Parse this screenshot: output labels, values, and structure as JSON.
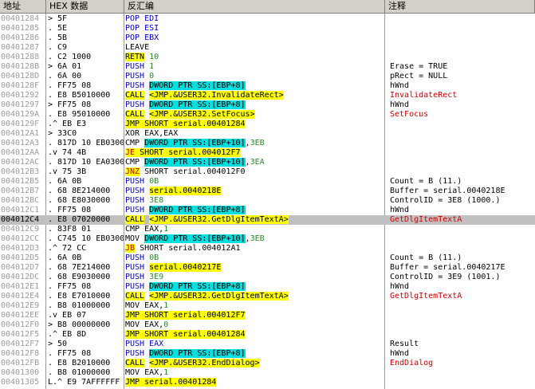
{
  "headers": {
    "address": "地址",
    "hex": "HEX 数据",
    "disasm": "反汇编",
    "comment": "注释"
  },
  "rows": [
    {
      "addr": "00401284",
      "hex": "> 5F",
      "dis": [
        [
          "POP EDI",
          "b"
        ]
      ],
      "com": ""
    },
    {
      "addr": "00401285",
      "hex": ". 5E",
      "dis": [
        [
          "POP ESI",
          "b"
        ]
      ],
      "com": ""
    },
    {
      "addr": "00401286",
      "hex": ". 5B",
      "dis": [
        [
          "POP EBX",
          "b"
        ]
      ],
      "com": ""
    },
    {
      "addr": "00401287",
      "hex": ". C9",
      "dis": [
        [
          "LEAVE",
          ""
        ]
      ],
      "com": ""
    },
    {
      "addr": "00401288",
      "hex": ". C2 1000",
      "dis": [
        [
          "RETN",
          "ky"
        ],
        [
          " 10",
          "g"
        ]
      ],
      "com": ""
    },
    {
      "addr": "0040128B",
      "hex": "> 6A 01",
      "dis": [
        [
          "PUSH ",
          "b"
        ],
        [
          "1",
          "g"
        ]
      ],
      "com": "Erase = TRUE"
    },
    {
      "addr": "0040128D",
      "hex": ". 6A 00",
      "dis": [
        [
          "PUSH ",
          "b"
        ],
        [
          "0",
          "g"
        ]
      ],
      "com": "pRect = NULL"
    },
    {
      "addr": "0040128F",
      "hex": ". FF75 08",
      "dis": [
        [
          "PUSH ",
          "b"
        ],
        [
          "DWORD PTR SS:[EBP+8]",
          "c"
        ]
      ],
      "com": "hWnd"
    },
    {
      "addr": "00401292",
      "hex": ". E8 B5010000",
      "dis": [
        [
          "CALL",
          "y"
        ],
        [
          " ",
          ""
        ],
        [
          "<JMP.&USER32.InvalidateRect>",
          "y"
        ]
      ],
      "com": "InvalidateRect",
      "comRed": true
    },
    {
      "addr": "00401297",
      "hex": "> FF75 08",
      "dis": [
        [
          "PUSH ",
          "b"
        ],
        [
          "DWORD PTR SS:[EBP+8]",
          "c"
        ]
      ],
      "com": "hWnd"
    },
    {
      "addr": "0040129A",
      "hex": ". E8 95010000",
      "dis": [
        [
          "CALL",
          "y"
        ],
        [
          " ",
          ""
        ],
        [
          "<JMP.&USER32.SetFocus>",
          "y"
        ]
      ],
      "com": "SetFocus",
      "comRed": true
    },
    {
      "addr": "0040129F",
      "hex": ".^ EB E3",
      "dis": [
        [
          "JMP SHORT serial.00401284",
          "y"
        ]
      ],
      "com": ""
    },
    {
      "addr": "004012A1",
      "hex": "> 33C0",
      "dis": [
        [
          "XOR EAX,EAX",
          ""
        ]
      ],
      "com": ""
    },
    {
      "addr": "004012A3",
      "hex": ". 817D 10 EB03000",
      "dis": [
        [
          "CMP ",
          ""
        ],
        [
          "DWORD PTR SS:[EBP+10]",
          "c"
        ],
        [
          ",",
          ""
        ],
        [
          "3EB",
          "g"
        ]
      ],
      "com": ""
    },
    {
      "addr": "004012AA",
      "hex": ".v 74 4B",
      "dis": [
        [
          "JE",
          "yr"
        ],
        [
          " SHORT serial.004012F7",
          "y"
        ]
      ],
      "com": ""
    },
    {
      "addr": "004012AC",
      "hex": ". 817D 10 EA03000",
      "dis": [
        [
          "CMP ",
          ""
        ],
        [
          "DWORD PTR SS:[EBP+10]",
          "c"
        ],
        [
          ",",
          ""
        ],
        [
          "3EA",
          "g"
        ]
      ],
      "com": ""
    },
    {
      "addr": "004012B3",
      "hex": ".v 75 3B",
      "dis": [
        [
          "JNZ",
          "yr"
        ],
        [
          " SHORT serial.004012F0",
          ""
        ]
      ],
      "com": ""
    },
    {
      "addr": "004012B5",
      "hex": ". 6A 0B",
      "dis": [
        [
          "PUSH ",
          "b"
        ],
        [
          "0B",
          "g"
        ]
      ],
      "com": "Count = B (11.)"
    },
    {
      "addr": "004012B7",
      "hex": ". 68 8E214000",
      "dis": [
        [
          "PUSH ",
          "b"
        ],
        [
          "serial.0040218E",
          "y"
        ]
      ],
      "com": "Buffer = serial.0040218E"
    },
    {
      "addr": "004012BC",
      "hex": ". 68 E8030000",
      "dis": [
        [
          "PUSH ",
          "b"
        ],
        [
          "3E8",
          "g"
        ]
      ],
      "com": "ControlID = 3E8 (1000.)"
    },
    {
      "addr": "004012C1",
      "hex": ". FF75 08",
      "dis": [
        [
          "PUSH ",
          "b"
        ],
        [
          "DWORD PTR SS:[EBP+8]",
          "c"
        ]
      ],
      "com": "hWnd"
    },
    {
      "addr": "004012C4",
      "hex": ". E8 07020000",
      "dis": [
        [
          "CALL",
          "y"
        ],
        [
          " ",
          ""
        ],
        [
          "<JMP.&USER32.GetDlgItemTextA>",
          "y"
        ]
      ],
      "com": "GetDlgItemTextA",
      "comRed": true,
      "sel": true
    },
    {
      "addr": "004012C9",
      "hex": ". 83F8 01",
      "dis": [
        [
          "CMP EAX,",
          ""
        ],
        [
          "1",
          "g"
        ]
      ],
      "com": ""
    },
    {
      "addr": "004012CC",
      "hex": ". C745 10 EB03000",
      "dis": [
        [
          "MOV ",
          ""
        ],
        [
          "DWORD PTR SS:[EBP+10]",
          "c"
        ],
        [
          ",",
          ""
        ],
        [
          "3EB",
          "g"
        ]
      ],
      "com": ""
    },
    {
      "addr": "004012D3",
      "hex": ".^ 72 CC",
      "dis": [
        [
          "JB",
          "yr"
        ],
        [
          " SHORT serial.004012A1",
          ""
        ]
      ],
      "com": ""
    },
    {
      "addr": "004012D5",
      "hex": ". 6A 0B",
      "dis": [
        [
          "PUSH ",
          "b"
        ],
        [
          "0B",
          "g"
        ]
      ],
      "com": "Count = B (11.)"
    },
    {
      "addr": "004012D7",
      "hex": ". 68 7E214000",
      "dis": [
        [
          "PUSH ",
          "b"
        ],
        [
          "serial.0040217E",
          "y"
        ]
      ],
      "com": "Buffer = serial.0040217E"
    },
    {
      "addr": "004012DC",
      "hex": ". 68 E9030000",
      "dis": [
        [
          "PUSH ",
          "b"
        ],
        [
          "3E9",
          "g"
        ]
      ],
      "com": "ControlID = 3E9 (1001.)"
    },
    {
      "addr": "004012E1",
      "hex": ". FF75 08",
      "dis": [
        [
          "PUSH ",
          "b"
        ],
        [
          "DWORD PTR SS:[EBP+8]",
          "c"
        ]
      ],
      "com": "hWnd"
    },
    {
      "addr": "004012E4",
      "hex": ". E8 E7010000",
      "dis": [
        [
          "CALL",
          "y"
        ],
        [
          " ",
          ""
        ],
        [
          "<JMP.&USER32.GetDlgItemTextA>",
          "y"
        ]
      ],
      "com": "GetDlgItemTextA",
      "comRed": true
    },
    {
      "addr": "004012E9",
      "hex": ". B8 01000000",
      "dis": [
        [
          "MOV EAX,",
          ""
        ],
        [
          "1",
          "g"
        ]
      ],
      "com": ""
    },
    {
      "addr": "004012EE",
      "hex": ".v EB 07",
      "dis": [
        [
          "JMP SHORT serial.004012F7",
          "y"
        ]
      ],
      "com": ""
    },
    {
      "addr": "004012F0",
      "hex": "> B8 00000000",
      "dis": [
        [
          "MOV EAX,",
          ""
        ],
        [
          "0",
          "g"
        ]
      ],
      "com": ""
    },
    {
      "addr": "004012F5",
      "hex": ".^ EB 8D",
      "dis": [
        [
          "JMP SHORT serial.00401284",
          "y"
        ]
      ],
      "com": ""
    },
    {
      "addr": "004012F7",
      "hex": "> 50",
      "dis": [
        [
          "PUSH EAX",
          "b"
        ]
      ],
      "com": "Result"
    },
    {
      "addr": "004012F8",
      "hex": ". FF75 08",
      "dis": [
        [
          "PUSH ",
          "b"
        ],
        [
          "DWORD PTR SS:[EBP+8]",
          "c"
        ]
      ],
      "com": "hWnd"
    },
    {
      "addr": "004012FB",
      "hex": ". E8 B2010000",
      "dis": [
        [
          "CALL",
          "y"
        ],
        [
          " ",
          ""
        ],
        [
          "<JMP.&USER32.EndDialog>",
          "y"
        ]
      ],
      "com": "EndDialog",
      "comRed": true
    },
    {
      "addr": "00401300",
      "hex": ". B8 01000000",
      "dis": [
        [
          "MOV EAX,",
          ""
        ],
        [
          "1",
          "g"
        ]
      ],
      "com": ""
    },
    {
      "addr": "00401305",
      "hex": "L.^ E9 7AFFFFFF",
      "dis": [
        [
          "JMP",
          "y"
        ],
        [
          " serial.00401284",
          "y"
        ]
      ],
      "com": ""
    }
  ]
}
